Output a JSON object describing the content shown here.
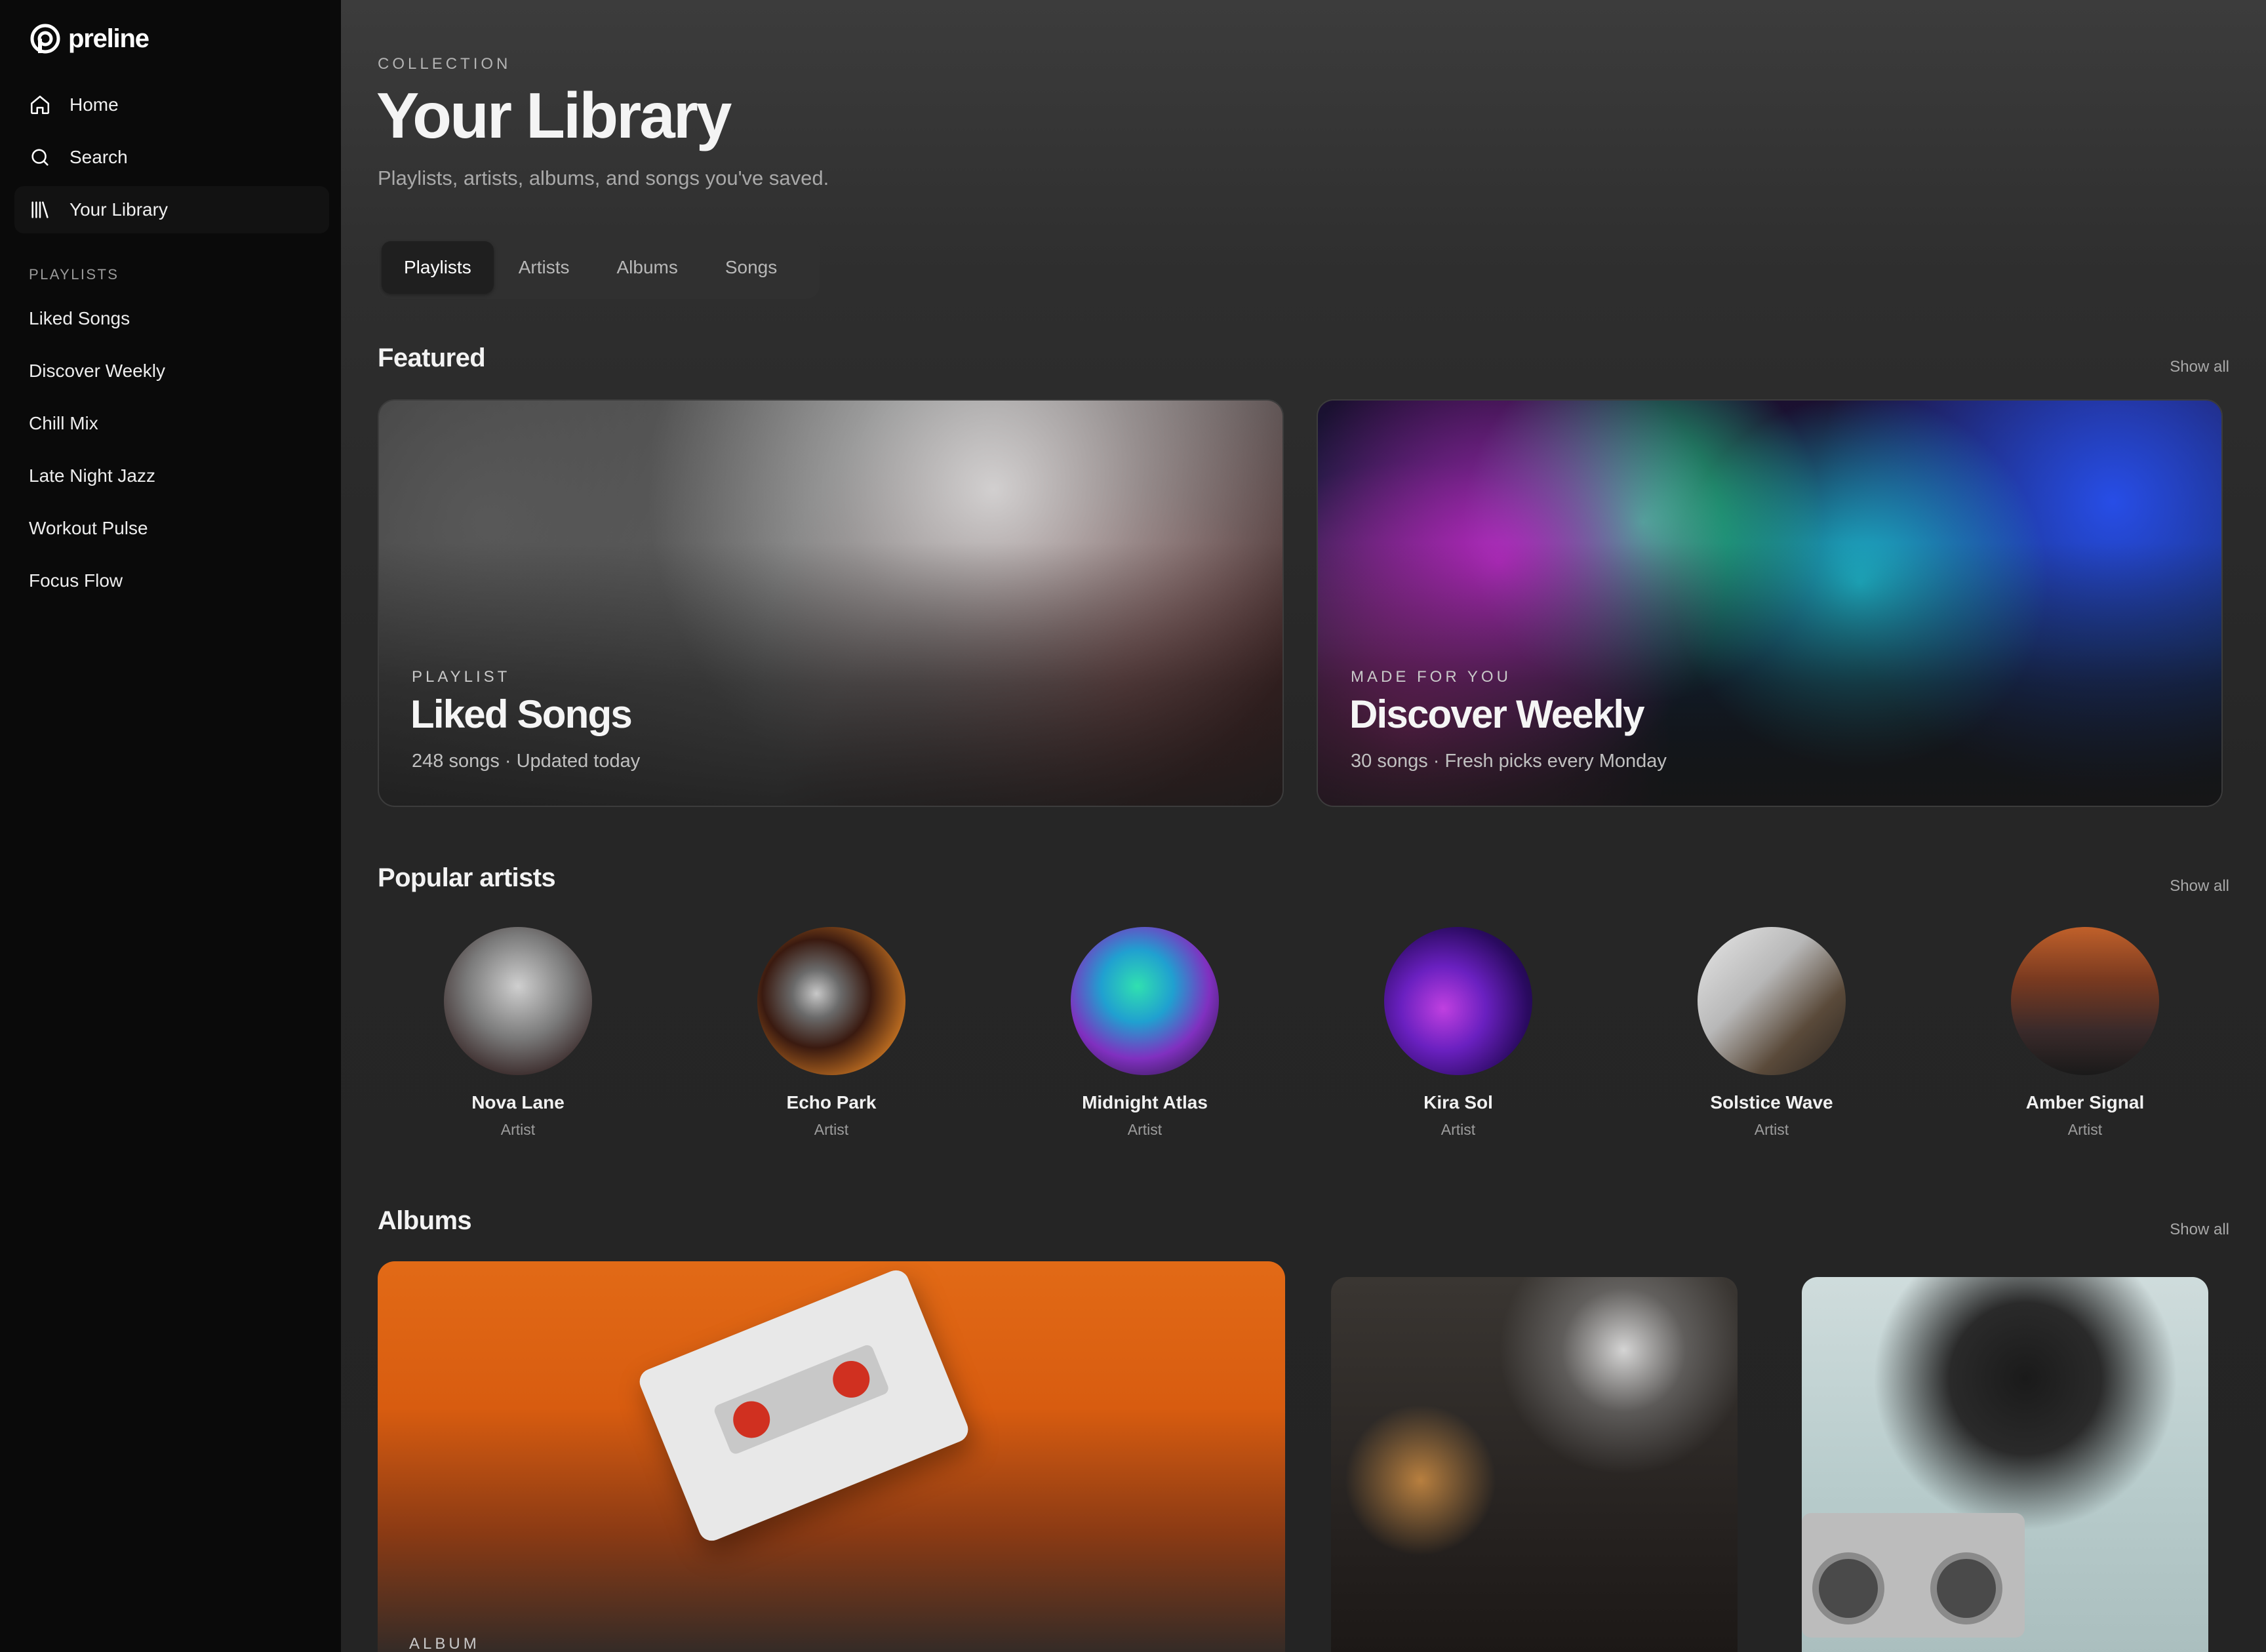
{
  "brand": {
    "name": "preline"
  },
  "nav": [
    {
      "label": "Home",
      "icon": "home-icon"
    },
    {
      "label": "Search",
      "icon": "search-icon"
    },
    {
      "label": "Your Library",
      "icon": "library-icon",
      "active": true
    }
  ],
  "sidebar": {
    "section_title": "PLAYLISTS",
    "playlists": [
      "Liked Songs",
      "Discover Weekly",
      "Chill Mix",
      "Late Night Jazz",
      "Workout Pulse",
      "Focus Flow"
    ]
  },
  "header": {
    "eyebrow": "COLLECTION",
    "title": "Your Library",
    "subtitle": "Playlists, artists, albums, and songs you've saved."
  },
  "tabs": [
    {
      "label": "Playlists",
      "active": true
    },
    {
      "label": "Artists"
    },
    {
      "label": "Albums"
    },
    {
      "label": "Songs"
    }
  ],
  "featured": {
    "title": "Featured",
    "show_all": "Show all",
    "cards": [
      {
        "eyebrow": "PLAYLIST",
        "title": "Liked Songs",
        "meta": "248 songs · Updated today"
      },
      {
        "eyebrow": "MADE FOR YOU",
        "title": "Discover Weekly",
        "meta": "30 songs · Fresh picks every Monday"
      }
    ]
  },
  "artists": {
    "title": "Popular artists",
    "show_all": "Show all",
    "items": [
      {
        "name": "Nova Lane",
        "role": "Artist"
      },
      {
        "name": "Echo Park",
        "role": "Artist"
      },
      {
        "name": "Midnight Atlas",
        "role": "Artist"
      },
      {
        "name": "Kira Sol",
        "role": "Artist"
      },
      {
        "name": "Solstice Wave",
        "role": "Artist"
      },
      {
        "name": "Amber Signal",
        "role": "Artist"
      }
    ]
  },
  "albums": {
    "title": "Albums",
    "show_all": "Show all",
    "big_eyebrow": "ALBUM"
  }
}
